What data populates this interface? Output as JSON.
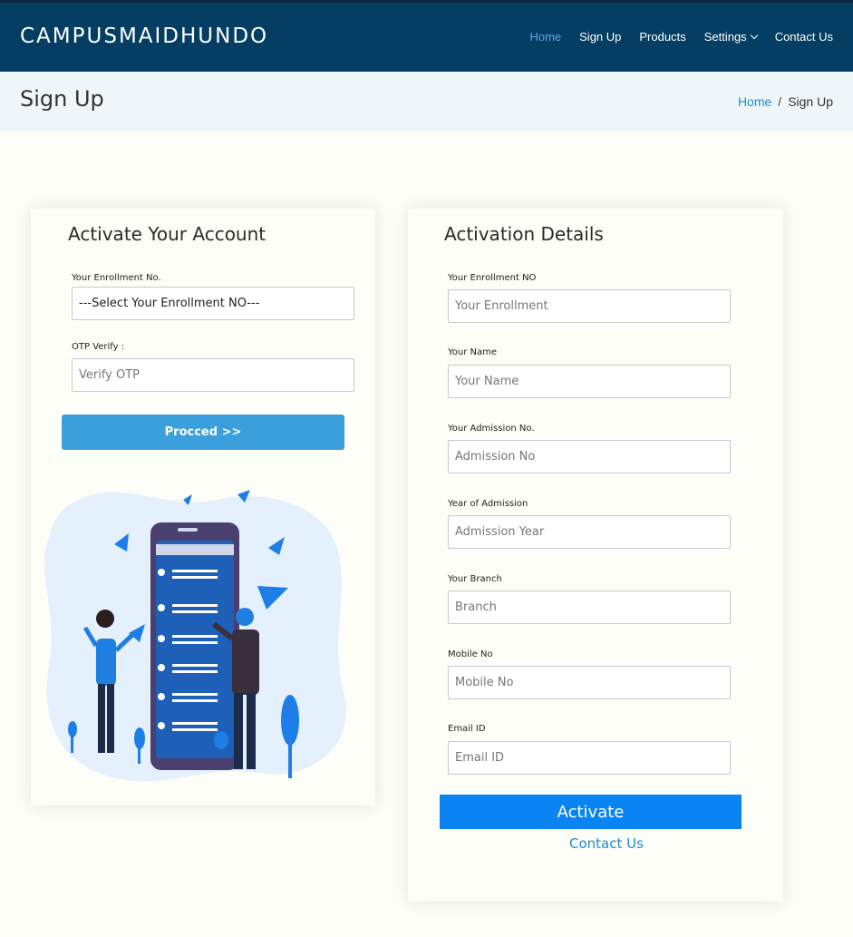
{
  "header": {
    "brand": "CAMPUSMAIDHUNDO",
    "nav": [
      {
        "label": "Home",
        "active": true
      },
      {
        "label": "Sign Up"
      },
      {
        "label": "Products"
      },
      {
        "label": "Settings"
      },
      {
        "label": "Contact Us"
      }
    ]
  },
  "breadcrumb_bar": {
    "title": "Sign Up",
    "crumbs": [
      "Home",
      "/",
      "Sign Up"
    ]
  },
  "activate_card": {
    "title": "Activate Your Account",
    "enrollment_label": "Your Enrollment No.",
    "enrollment_select_value": "---Select Your Enrollment NO---",
    "otp_label": "OTP Verify :",
    "otp_placeholder": "Verify OTP",
    "proceed_label": "Procced >>"
  },
  "details_card": {
    "title": "Activation Details",
    "fields": [
      {
        "label": "Your Enrollment NO",
        "placeholder": "Your Enrollment"
      },
      {
        "label": "Your Name",
        "placeholder": "Your Name"
      },
      {
        "label": "Your Admission No.",
        "placeholder": "Admission No"
      },
      {
        "label": "Year of Admission",
        "placeholder": "Admission Year"
      },
      {
        "label": "Your Branch",
        "placeholder": "Branch"
      },
      {
        "label": "Mobile No",
        "placeholder": "Mobile No"
      },
      {
        "label": "Email ID",
        "placeholder": "Email ID"
      }
    ],
    "activate_label": "Activate",
    "contact_label": "Contact Us"
  },
  "colors": {
    "navbar": "#053e63",
    "nav_active": "#5aa6e0",
    "crumb_bg": "#eef6f9",
    "proceed_button": "#3a9fdb",
    "activate_button": "#0b84f3",
    "link": "#1b8bd8",
    "page_bg": "#fdfef8"
  },
  "icons": [
    "chevron-down-icon",
    "hamburger-icon",
    "search-icon",
    "paper-plane-icon"
  ]
}
